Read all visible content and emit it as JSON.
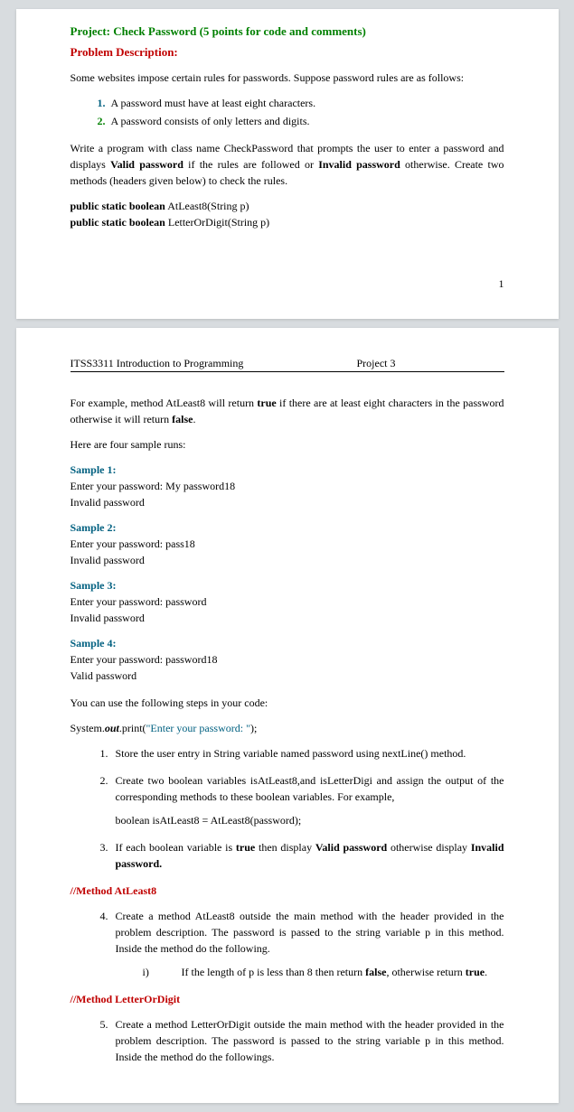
{
  "page1": {
    "projectTitle": "Project: Check Password (5 points for code and comments)",
    "problemDescLabel": "Problem Description:",
    "intro": "Some websites impose certain rules for passwords. Suppose password rules are as follows:",
    "rule1": "A password must have at least eight characters.",
    "rule2": "A password consists of only letters and digits.",
    "para2a": "Write a program with class name CheckPassword that prompts the user to enter a password and displays ",
    "valid": "Valid password",
    "para2b": " if the rules are followed or ",
    "invalid": "Invalid password",
    "para2c": " otherwise. Create two methods (headers given below) to check the rules.",
    "meth1pre": "public static boolean",
    "meth1post": " AtLeast8(String p)",
    "meth2pre": "public static boolean",
    "meth2post": " LetterOrDigit(String p)",
    "pageNum": "1"
  },
  "page2": {
    "hdrLeft": "ITSS3311 Introduction to Programming",
    "hdrRight": "Project 3",
    "para1a": "For example, method AtLeast8 will return ",
    "true": "true",
    "para1b": " if there are at least eight characters in the password otherwise it will return ",
    "false": "false",
    "para1c": ".",
    "hereare": "Here are four sample runs:",
    "s1label": "Sample 1:",
    "s1line1": "Enter your password: My password18",
    "s1line2": "Invalid password",
    "s2label": "Sample 2:",
    "s2line1": "Enter your password: pass18",
    "s2line2": "Invalid password",
    "s3label": "Sample 3:",
    "s3line1": "Enter your password: password",
    "s3line2": "Invalid password",
    "s4label": "Sample 4:",
    "s4line1": "Enter your password: password18",
    "s4line2": "Valid password",
    "stepsIntro": "You can use the following steps in your code:",
    "codeLine1a": "System.",
    "codeLine1b": "out",
    "codeLine1c": ".print(",
    "codeLine1d": "\"Enter your password: \"",
    "codeLine1e": ");",
    "step1": "Store the user entry in String variable named password using nextLine() method.",
    "step2": "Create two boolean variables isAtLeast8,and  isLetterDigi and assign the output of the corresponding methods to these boolean variables. For example,",
    "step2code": "boolean isAtLeast8 = AtLeast8(password);",
    "step3a": "If each boolean variable is ",
    "step3true": "true",
    "step3b": " then display ",
    "step3valid": "Valid password",
    "step3c": " otherwise display ",
    "step3invalid": "Invalid password.",
    "methodAtLeast8": "//Method AtLeast8",
    "step4a": "Create a method AtLeast8 outside the main method with the header provided in the problem description. The password is passed to the string variable p in this method. Inside the method do the following.",
    "step4ia": "i)",
    "step4ib": "If the length of p is less than 8 then return ",
    "step4false": "false",
    "step4ic": ", otherwise return ",
    "step4true": "true",
    "step4id": ".",
    "methodLetterOrDigit": "//Method LetterOrDigit",
    "step5": "Create a method LetterOrDigit outside the main method with the header provided in the problem description. The password is passed to the string variable p in this method. Inside the method do the followings."
  }
}
